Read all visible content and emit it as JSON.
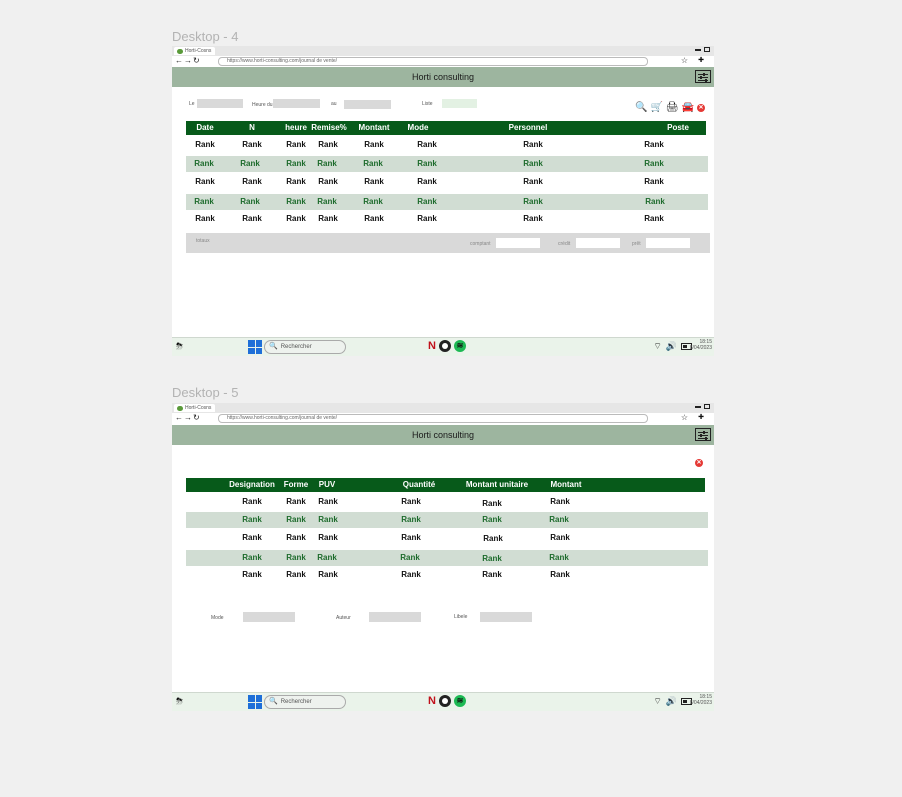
{
  "screens": [
    {
      "frame_label": "Desktop - 4",
      "browser": {
        "tab_title": "Horti-Cosns",
        "url": "https://www.horti-consulting.com/journal de vente/"
      },
      "app_title": "Horti consulting",
      "filters": {
        "le_label": "Le",
        "heure_label": "Heure du",
        "au_label": "au",
        "liste_label": "Liste"
      },
      "table": {
        "headers": [
          "Date",
          "N",
          "heure",
          "Remise%",
          "Montant",
          "Mode",
          "Personnel",
          "Poste"
        ],
        "rows": [
          [
            "Rank",
            "Rank",
            "Rank",
            "Rank",
            "Rank",
            "Rank",
            "Rank",
            "Rank"
          ],
          [
            "Rank",
            "Rank",
            "Rank",
            "Rank",
            "Rank",
            "Rank",
            "Rank",
            "Rank"
          ],
          [
            "Rank",
            "Rank",
            "Rank",
            "Rank",
            "Rank",
            "Rank",
            "Rank",
            "Rank"
          ],
          [
            "Rank",
            "Rank",
            "Rank",
            "Rank",
            "Rank",
            "Rank",
            "Rank",
            "Rank"
          ],
          [
            "Rank",
            "Rank",
            "Rank",
            "Rank",
            "Rank",
            "Rank",
            "Rank",
            "Rank"
          ]
        ]
      },
      "totals": {
        "label": "totaux",
        "comptant_label": "comptant",
        "credit_label": "crédit",
        "pret_label": "prêt"
      },
      "taskbar": {
        "search_placeholder": "Rechercher",
        "time": "18:15",
        "date": "8/04/2023"
      }
    },
    {
      "frame_label": "Desktop - 5",
      "browser": {
        "tab_title": "Horti-Cosns",
        "url": "https://www.horti-consulting.com/journal de vente/"
      },
      "app_title": "Horti consulting",
      "table": {
        "headers": [
          "Designation",
          "Forme",
          "PUV",
          "Quantité",
          "Montant unitaire",
          "Montant"
        ],
        "rows": [
          [
            "Rank",
            "Rank",
            "Rank",
            "Rank",
            "Rank",
            "Rank"
          ],
          [
            "Rank",
            "Rank",
            "Rank",
            "Rank",
            "Rank",
            "Rank"
          ],
          [
            "Rank",
            "Rank",
            "Rank",
            "Rank",
            "Rank",
            "Rank"
          ],
          [
            "Rank",
            "Rank",
            "Rank",
            "Rank",
            "Rank",
            "Rank"
          ],
          [
            "Rank",
            "Rank",
            "Rank",
            "Rank",
            "Rank",
            "Rank"
          ]
        ]
      },
      "fields": {
        "mode_label": "Mode",
        "auteur_label": "Auteur",
        "libele_label": "Libele"
      },
      "taskbar": {
        "search_placeholder": "Rechercher",
        "time": "18:15",
        "date": "8/04/2023"
      }
    }
  ],
  "colors": {
    "header_green": "#075a1a",
    "appbar": "#9db59f",
    "row_alt": "#d1ddd3",
    "alt_text": "#1d6b2c",
    "close_red": "#e53935"
  },
  "icons": [
    "search-icon",
    "cart-icon",
    "print-icon",
    "car-icon",
    "close-icon",
    "settings-icon",
    "weather-icon",
    "windows-icon",
    "wifi-icon",
    "volume-icon",
    "battery-icon"
  ]
}
